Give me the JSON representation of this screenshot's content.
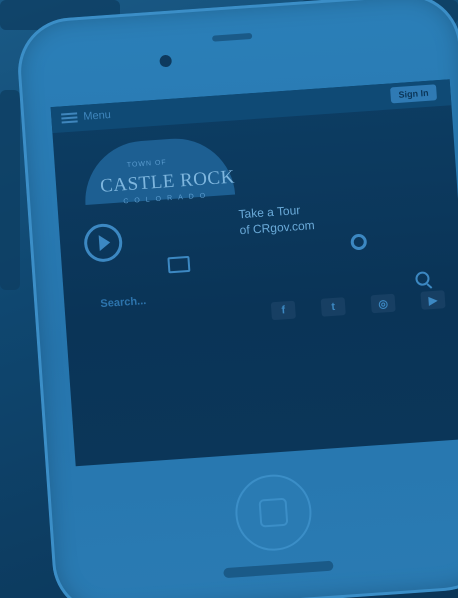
{
  "header": {
    "menu_label": "Menu",
    "signin_label": "Sign In"
  },
  "logo": {
    "small": "TOWN OF",
    "main": "CASTLE ROCK",
    "sub": "COLORADO"
  },
  "tour": {
    "line1": "Take a Tour",
    "line2": "of CRgov.com"
  },
  "search": {
    "label": "Search..."
  },
  "social": [
    {
      "name": "facebook-icon",
      "glyph": "f"
    },
    {
      "name": "twitter-icon",
      "glyph": "t"
    },
    {
      "name": "instagram-icon",
      "glyph": "◎"
    },
    {
      "name": "youtube-icon",
      "glyph": "▶"
    }
  ],
  "colors": {
    "tint": "#0f4770",
    "accent": "#3c88c2"
  }
}
